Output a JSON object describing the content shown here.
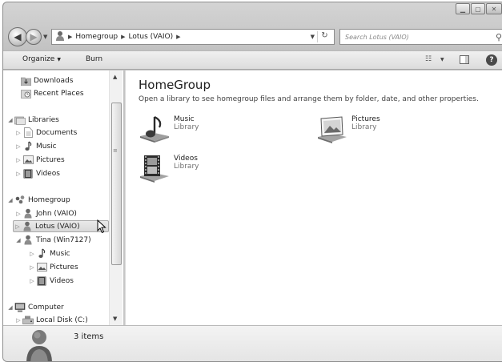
{
  "address": {
    "crumbs": [
      "Homegroup",
      "Lotus (VAIO)"
    ],
    "search_placeholder": "Search Lotus (VAIO)"
  },
  "toolbar": {
    "organize_label": "Organize",
    "burn_label": "Burn"
  },
  "nav": {
    "downloads": "Downloads",
    "recent_places": "Recent Places",
    "libraries": "Libraries",
    "lib_documents": "Documents",
    "lib_music": "Music",
    "lib_pictures": "Pictures",
    "lib_videos": "Videos",
    "homegroup": "Homegroup",
    "john": "John (VAIO)",
    "lotus": "Lotus (VAIO)",
    "tina": "Tina (Win7127)",
    "tina_music": "Music",
    "tina_pictures": "Pictures",
    "tina_videos": "Videos",
    "computer": "Computer",
    "local_disk": "Local Disk (C:)"
  },
  "content": {
    "title": "HomeGroup",
    "subtitle": "Open a library to see homegroup files and arrange them by folder, date, and other properties.",
    "libraries": [
      {
        "name": "Music",
        "kind": "Library",
        "icon": "music-library-icon"
      },
      {
        "name": "Pictures",
        "kind": "Library",
        "icon": "pictures-library-icon"
      },
      {
        "name": "Videos",
        "kind": "Library",
        "icon": "videos-library-icon"
      }
    ]
  },
  "details": {
    "count": "3 items"
  }
}
